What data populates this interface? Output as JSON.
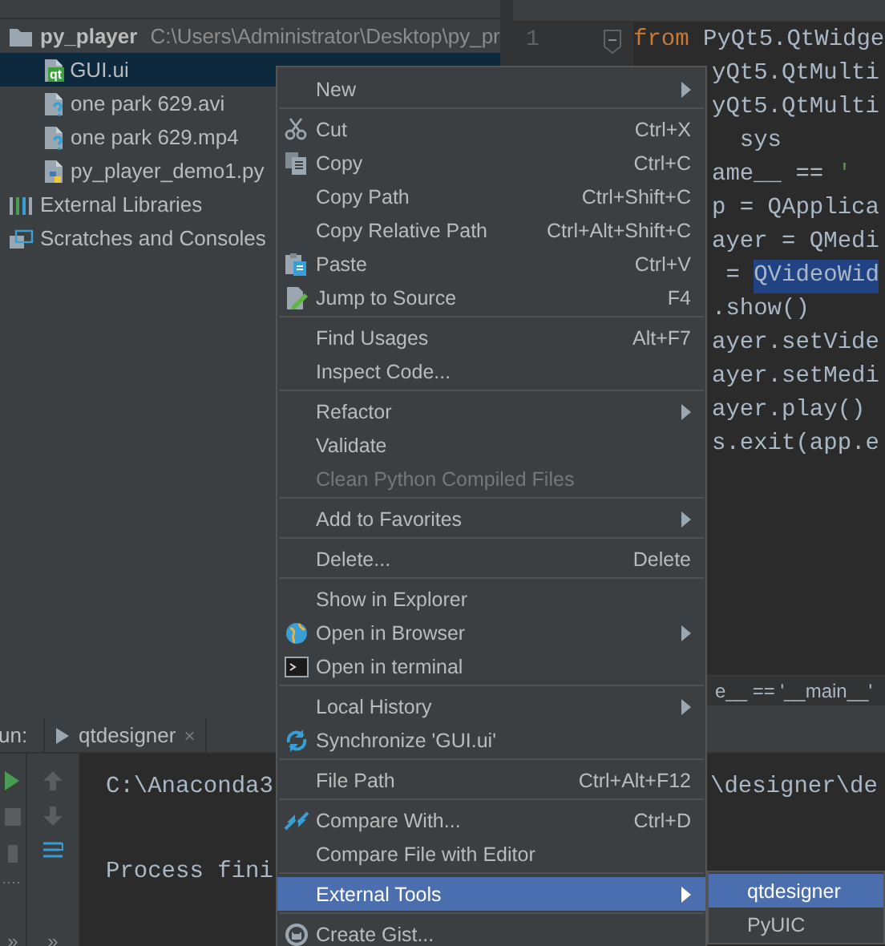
{
  "project_tree": {
    "items": [
      {
        "kind": "folder",
        "label": "py_player",
        "path": "C:\\Users\\Administrator\\Desktop\\py_pr",
        "selected": false,
        "children": [
          {
            "kind": "qt",
            "label": "GUI.ui",
            "badge": "qt",
            "selected": true
          },
          {
            "kind": "unknown",
            "label": "one park 629.avi",
            "selected": false
          },
          {
            "kind": "unknown",
            "label": "one park 629.mp4",
            "selected": false
          },
          {
            "kind": "python",
            "label": "py_player_demo1.py",
            "selected": false
          }
        ]
      },
      {
        "kind": "libraries",
        "label": "External Libraries",
        "selected": false
      },
      {
        "kind": "scratches",
        "label": "Scratches and Consoles",
        "selected": false
      }
    ]
  },
  "editor": {
    "line_numbers": [
      "1"
    ],
    "lines": [
      {
        "kind": "start",
        "tokens": [
          {
            "kind": "keyword",
            "text": "from"
          },
          {
            "kind": "plain",
            "text": " PyQt5.QtWidge"
          }
        ]
      },
      {
        "kind": "tail",
        "tokens": [
          {
            "kind": "plain",
            "text": "yQt5.QtMulti"
          }
        ]
      },
      {
        "kind": "tail",
        "tokens": [
          {
            "kind": "plain",
            "text": "yQt5.QtMulti"
          }
        ]
      },
      {
        "kind": "tail",
        "tokens": [
          {
            "kind": "plain",
            "text": "  sys"
          }
        ]
      },
      {
        "kind": "tail",
        "tokens": [
          {
            "kind": "plain",
            "text": "ame__ == "
          },
          {
            "kind": "string",
            "text": "'"
          }
        ]
      },
      {
        "kind": "tail",
        "tokens": [
          {
            "kind": "plain",
            "text": "p = QApplica"
          }
        ]
      },
      {
        "kind": "tail",
        "tokens": [
          {
            "kind": "plain",
            "text": "ayer = QMedi"
          }
        ]
      },
      {
        "kind": "tail",
        "tokens": [
          {
            "kind": "plain",
            "text": " = "
          },
          {
            "kind": "selection",
            "text": "QVideoWid"
          }
        ]
      },
      {
        "kind": "tail",
        "tokens": [
          {
            "kind": "plain",
            "text": ".show()"
          }
        ]
      },
      {
        "kind": "tail",
        "tokens": [
          {
            "kind": "plain",
            "text": "ayer.setVide"
          }
        ]
      },
      {
        "kind": "tail",
        "tokens": [
          {
            "kind": "plain",
            "text": "ayer.setMedi"
          }
        ]
      },
      {
        "kind": "tail",
        "tokens": [
          {
            "kind": "plain",
            "text": "ayer.play()"
          }
        ]
      },
      {
        "kind": "tail",
        "tokens": [
          {
            "kind": "plain",
            "text": "s.exit(app.e"
          }
        ]
      }
    ],
    "breadcrumb": "e__ == '__main__'"
  },
  "run_panel": {
    "label": "un:",
    "tab": {
      "label": "qtdesigner",
      "close": "×"
    },
    "toolbar_more": [
      "»",
      "»"
    ],
    "console": [
      {
        "text": "C:\\Anaconda3",
        "tail": "\\designer\\de"
      },
      {
        "text": "Process fini"
      }
    ]
  },
  "context_menu": {
    "items": [
      {
        "kind": "item",
        "label": "New",
        "submenu": true,
        "disabled": false,
        "selected": false
      },
      {
        "kind": "separator"
      },
      {
        "kind": "item",
        "label": "Cut",
        "shortcut": "Ctrl+X",
        "submenu": false,
        "disabled": false,
        "selected": false
      },
      {
        "kind": "item",
        "label": "Copy",
        "shortcut": "Ctrl+C",
        "submenu": false,
        "disabled": false,
        "selected": false
      },
      {
        "kind": "item",
        "label": "Copy Path",
        "shortcut": "Ctrl+Shift+C",
        "submenu": false,
        "disabled": false,
        "selected": false
      },
      {
        "kind": "item",
        "label": "Copy Relative Path",
        "shortcut": "Ctrl+Alt+Shift+C",
        "submenu": false,
        "disabled": false,
        "selected": false
      },
      {
        "kind": "item",
        "label": "Paste",
        "shortcut": "Ctrl+V",
        "submenu": false,
        "disabled": false,
        "selected": false
      },
      {
        "kind": "item",
        "label": "Jump to Source",
        "shortcut": "F4",
        "submenu": false,
        "disabled": false,
        "selected": false
      },
      {
        "kind": "separator"
      },
      {
        "kind": "item",
        "label": "Find Usages",
        "shortcut": "Alt+F7",
        "submenu": false,
        "disabled": false,
        "selected": false
      },
      {
        "kind": "item",
        "label": "Inspect Code...",
        "submenu": false,
        "disabled": false,
        "selected": false
      },
      {
        "kind": "separator"
      },
      {
        "kind": "item",
        "label": "Refactor",
        "submenu": true,
        "disabled": false,
        "selected": false
      },
      {
        "kind": "item",
        "label": "Validate",
        "submenu": false,
        "disabled": false,
        "selected": false
      },
      {
        "kind": "item",
        "label": "Clean Python Compiled Files",
        "submenu": false,
        "disabled": true,
        "selected": false
      },
      {
        "kind": "separator"
      },
      {
        "kind": "item",
        "label": "Add to Favorites",
        "submenu": true,
        "disabled": false,
        "selected": false
      },
      {
        "kind": "separator"
      },
      {
        "kind": "item",
        "label": "Delete...",
        "shortcut": "Delete",
        "submenu": false,
        "disabled": false,
        "selected": false
      },
      {
        "kind": "separator"
      },
      {
        "kind": "item",
        "label": "Show in Explorer",
        "submenu": false,
        "disabled": false,
        "selected": false
      },
      {
        "kind": "item",
        "label": "Open in Browser",
        "submenu": true,
        "disabled": false,
        "selected": false
      },
      {
        "kind": "item",
        "label": "Open in terminal",
        "submenu": false,
        "disabled": false,
        "selected": false
      },
      {
        "kind": "separator"
      },
      {
        "kind": "item",
        "label": "Local History",
        "submenu": true,
        "disabled": false,
        "selected": false
      },
      {
        "kind": "item",
        "label": "Synchronize 'GUI.ui'",
        "submenu": false,
        "disabled": false,
        "selected": false
      },
      {
        "kind": "separator"
      },
      {
        "kind": "item",
        "label": "File Path",
        "shortcut": "Ctrl+Alt+F12",
        "submenu": false,
        "disabled": false,
        "selected": false
      },
      {
        "kind": "separator"
      },
      {
        "kind": "item",
        "label": "Compare With...",
        "shortcut": "Ctrl+D",
        "submenu": false,
        "disabled": false,
        "selected": false
      },
      {
        "kind": "item",
        "label": "Compare File with Editor",
        "submenu": false,
        "disabled": false,
        "selected": false
      },
      {
        "kind": "separator"
      },
      {
        "kind": "item",
        "label": "External Tools",
        "submenu": true,
        "disabled": false,
        "selected": true
      },
      {
        "kind": "separator"
      },
      {
        "kind": "item",
        "label": "Create Gist...",
        "submenu": false,
        "disabled": false,
        "selected": false
      }
    ]
  },
  "submenu": {
    "items": [
      {
        "label": "qtdesigner",
        "selected": true
      },
      {
        "label": "PyUIC",
        "selected": false
      }
    ]
  }
}
